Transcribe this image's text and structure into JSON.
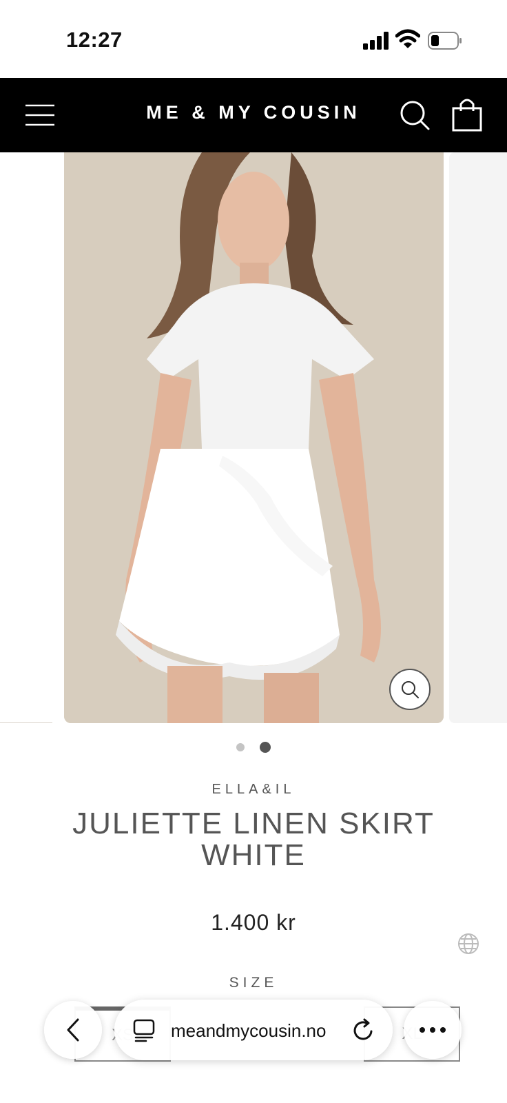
{
  "status_bar": {
    "time": "12:27"
  },
  "header": {
    "brand": "ME & MY COUSIN"
  },
  "gallery": {
    "current_index": 2,
    "total": 2
  },
  "product": {
    "brand": "ELLA&IL",
    "title": "JULIETTE LINEN SKIRT WHITE",
    "price": "1.400 kr",
    "size_label": "SIZE",
    "sizes_visible": [
      "XS",
      "XL"
    ]
  },
  "browser": {
    "url": "meandmycousin.no"
  },
  "colors": {
    "header_bg": "#000000",
    "text_muted": "#555555",
    "photo_bg": "#d8cebf"
  }
}
